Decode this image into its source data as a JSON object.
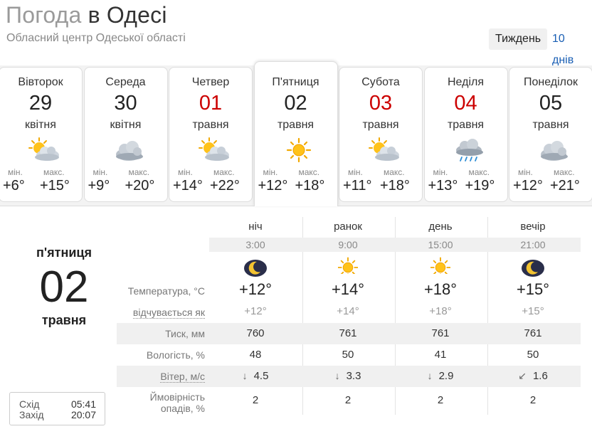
{
  "header": {
    "title_prefix": "Погода",
    "title_city": "в Одесі",
    "subtitle": "Обласний центр Одеської області"
  },
  "tabs": {
    "week": "Тиждень",
    "ten_days": "10 днів"
  },
  "labels": {
    "min": "мін.",
    "max": "макс."
  },
  "days": [
    {
      "name": "Вівторок",
      "date": "29",
      "month": "квітня",
      "min": "+6°",
      "max": "+15°",
      "icon": "partly-cloudy-icon",
      "red": false
    },
    {
      "name": "Середа",
      "date": "30",
      "month": "квітня",
      "min": "+9°",
      "max": "+20°",
      "icon": "cloudy-icon",
      "red": false
    },
    {
      "name": "Четвер",
      "date": "01",
      "month": "травня",
      "min": "+14°",
      "max": "+22°",
      "icon": "partly-cloudy-icon",
      "red": true
    },
    {
      "name": "П'ятниця",
      "date": "02",
      "month": "травня",
      "min": "+12°",
      "max": "+18°",
      "icon": "sun-icon",
      "red": false
    },
    {
      "name": "Субота",
      "date": "03",
      "month": "травня",
      "min": "+11°",
      "max": "+18°",
      "icon": "partly-cloudy-icon",
      "red": true
    },
    {
      "name": "Неділя",
      "date": "04",
      "month": "травня",
      "min": "+13°",
      "max": "+19°",
      "icon": "rain-cloud-icon",
      "red": true
    },
    {
      "name": "Понеділок",
      "date": "05",
      "month": "травня",
      "min": "+12°",
      "max": "+21°",
      "icon": "cloudy-icon",
      "red": false
    }
  ],
  "selected": {
    "name": "п'ятниця",
    "date": "02",
    "month": "травня"
  },
  "sun": {
    "rise_label": "Схід",
    "rise": "05:41",
    "set_label": "Захід",
    "set": "20:07"
  },
  "detail": {
    "periods": [
      {
        "name": "ніч",
        "time": "3:00",
        "icon": "moon-icon",
        "temp": "+12°",
        "feels": "+12°",
        "pressure": "760",
        "humidity": "48",
        "wind_dir": "↓",
        "wind": "4.5",
        "precip": "2"
      },
      {
        "name": "ранок",
        "time": "9:00",
        "icon": "sun-icon",
        "temp": "+14°",
        "feels": "+14°",
        "pressure": "761",
        "humidity": "50",
        "wind_dir": "↓",
        "wind": "3.3",
        "precip": "2"
      },
      {
        "name": "день",
        "time": "15:00",
        "icon": "sun-icon",
        "temp": "+18°",
        "feels": "+18°",
        "pressure": "761",
        "humidity": "41",
        "wind_dir": "↓",
        "wind": "2.9",
        "precip": "2"
      },
      {
        "name": "вечір",
        "time": "21:00",
        "icon": "moon-icon",
        "temp": "+15°",
        "feels": "+15°",
        "pressure": "761",
        "humidity": "50",
        "wind_dir": "↙",
        "wind": "1.6",
        "precip": "2"
      }
    ],
    "row_labels": {
      "temp": "Температура, °C",
      "feels": "відчувається як",
      "pressure": "Тиск, мм",
      "humidity": "Вологість, %",
      "wind": "Вітер, м/с",
      "precip_1": "Ймовірність",
      "precip_2": "опадів, %"
    }
  },
  "colors": {
    "accent_link": "#1a5fb4",
    "holiday_red": "#cc0000"
  }
}
